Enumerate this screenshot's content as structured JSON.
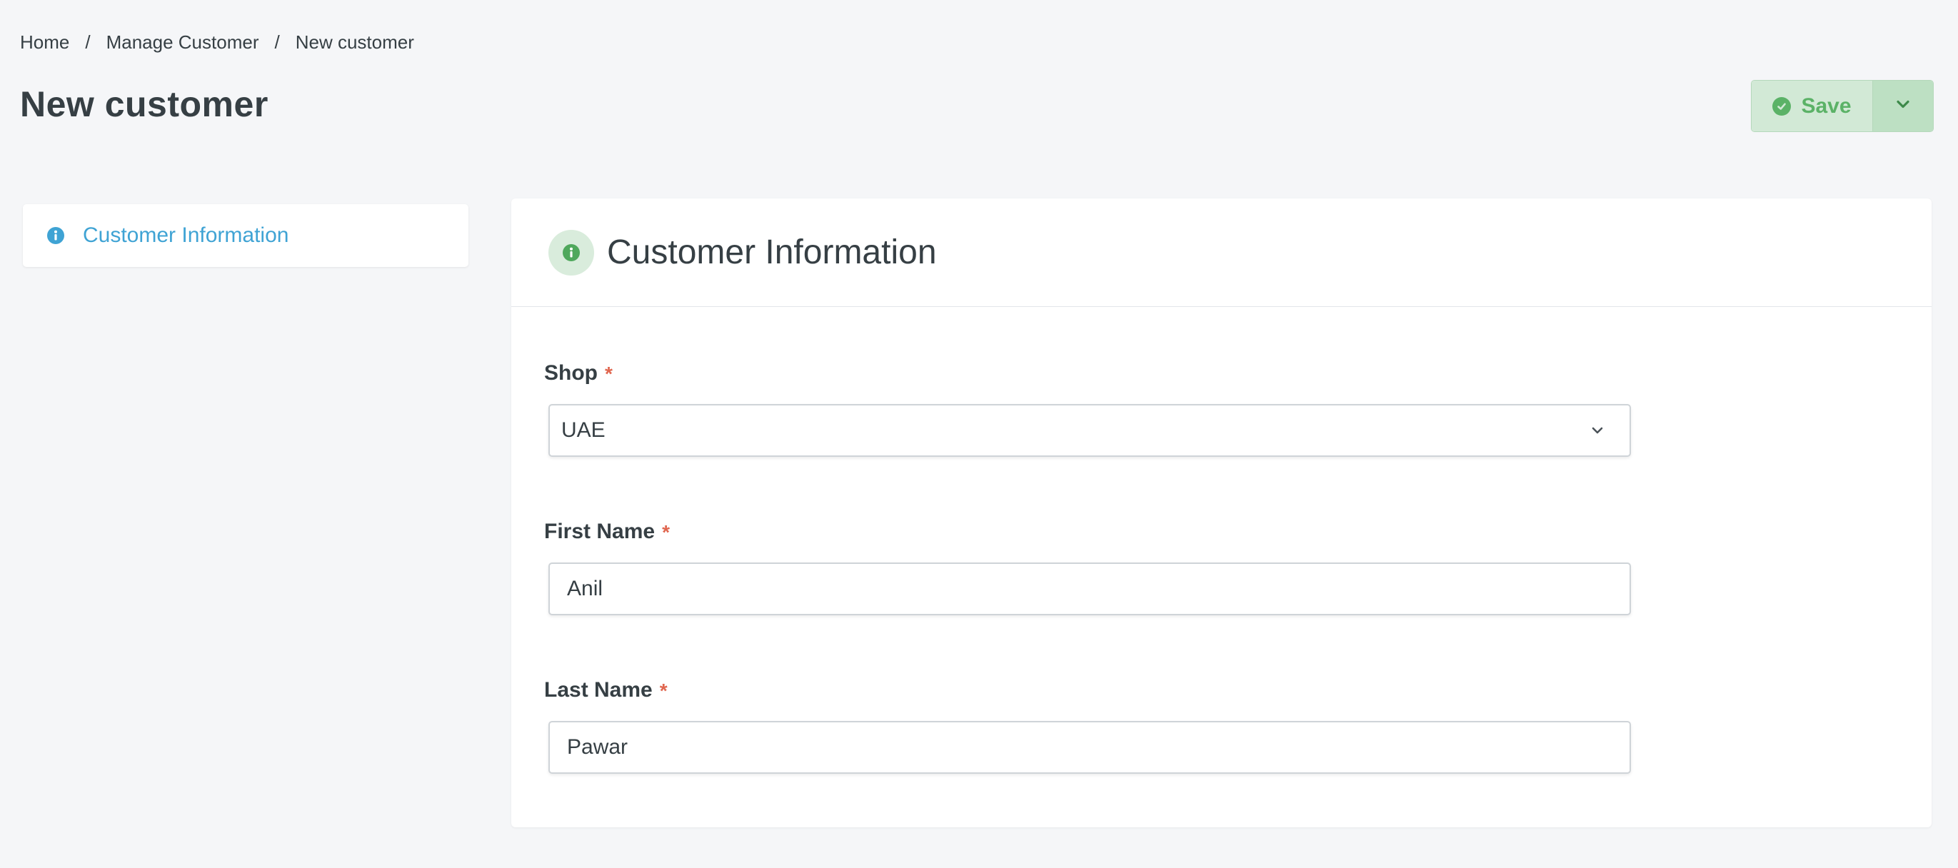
{
  "breadcrumb": {
    "items": [
      "Home",
      "Manage Customer",
      "New customer"
    ],
    "separator": "/"
  },
  "page": {
    "title": "New customer"
  },
  "toolbar": {
    "save_label": "Save",
    "save_icon": "check-circle-icon",
    "dropdown_icon": "chevron-down-icon"
  },
  "sidebar": {
    "items": [
      {
        "label": "Customer Information",
        "icon": "info-icon",
        "active": true
      }
    ]
  },
  "section": {
    "title": "Customer Information",
    "icon": "info-icon"
  },
  "form": {
    "shop": {
      "label": "Shop",
      "required_mark": "*",
      "value": "UAE"
    },
    "first_name": {
      "label": "First Name",
      "required_mark": "*",
      "value": "Anil"
    },
    "last_name": {
      "label": "Last Name",
      "required_mark": "*",
      "value": "Pawar"
    }
  },
  "colors": {
    "background": "#f5f6f8",
    "text": "#363f44",
    "link_blue": "#3fa3d4",
    "save_green": "#5bb267",
    "required_red": "#e0664f"
  }
}
